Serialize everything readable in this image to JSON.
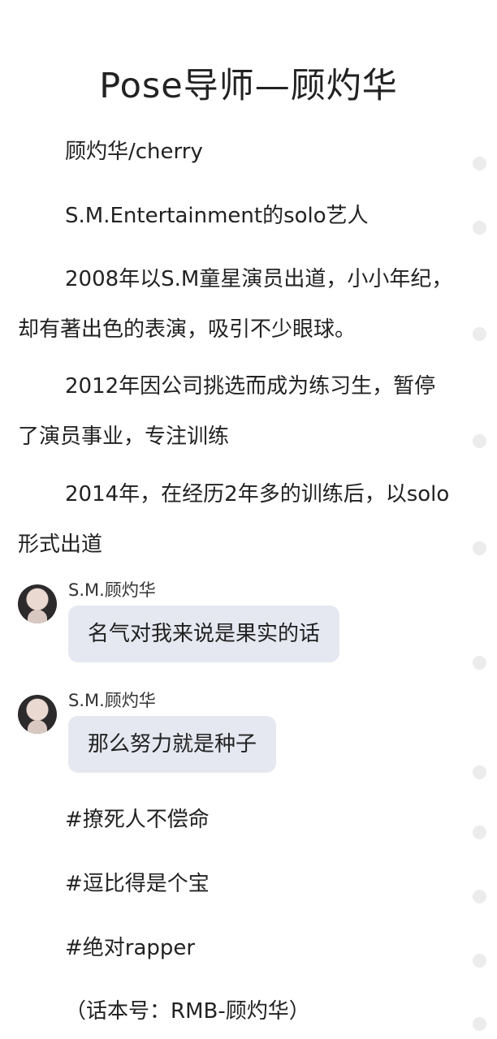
{
  "article": {
    "title": "Pose导师—顾灼华",
    "paragraphs": [
      "顾灼华/cherry",
      "S.M.Entertainment的solo艺人",
      "2008年以S.M童星演员出道，小小年纪，却有著出色的表演，吸引不少眼球。",
      "2012年因公司挑选而成为练习生，暂停了演员事业，专注训练",
      "2014年，在经历2年多的训练后，以solo形式出道"
    ],
    "messages": [
      {
        "sender": "S.M.顾灼华",
        "text": "名气对我来说是果实的话"
      },
      {
        "sender": "S.M.顾灼华",
        "text": "那么努力就是种子"
      }
    ],
    "tags": [
      "#撩死人不偿命",
      "#逗比得是个宝",
      "#绝对rapper"
    ],
    "footer": "（话本号：RMB-顾灼华）"
  },
  "icons": {
    "avatar": "user-avatar",
    "side_dot": "dot-icon"
  },
  "colors": {
    "background": "#ffffff",
    "text": "#222222",
    "bubble": "#e5e8f0",
    "dot": "#ececec"
  }
}
